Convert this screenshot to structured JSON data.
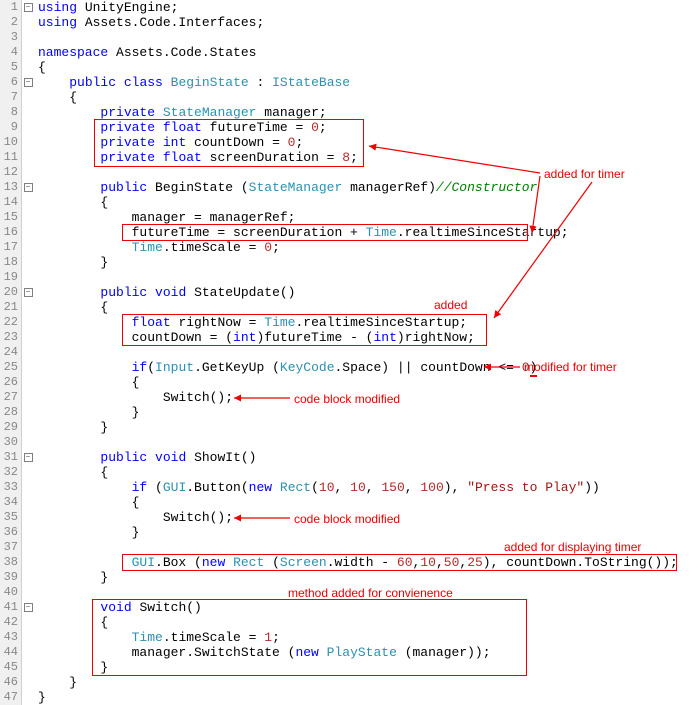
{
  "lines": {
    "l1": [
      "using ",
      "UnityEngine",
      ";"
    ],
    "l2": [
      "using ",
      "Assets.Code.Interfaces",
      ";"
    ],
    "l4": [
      "namespace ",
      "Assets.Code.States"
    ],
    "l6": [
      "    ",
      "public",
      "class",
      "BeginState",
      " : ",
      "IStateBase"
    ],
    "l8": [
      "        ",
      "private",
      "StateManager",
      " manager;"
    ],
    "l9": [
      "        ",
      "private",
      "float",
      " futureTime = ",
      "0",
      ";"
    ],
    "l10": [
      "        ",
      "private",
      "int",
      " countDown = ",
      "0",
      ";"
    ],
    "l11": [
      "        ",
      "private",
      "float",
      " screenDuration = ",
      "8",
      ";"
    ],
    "l13": [
      "        ",
      "public",
      " BeginState (",
      "StateManager",
      " managerRef)",
      "//Constructor"
    ],
    "l15": [
      "            manager = managerRef;"
    ],
    "l16": [
      "            futureTime = screenDuration + ",
      "Time",
      ".realtimeSinceStartup;"
    ],
    "l17": [
      "            ",
      "Time",
      ".timeScale = ",
      "0",
      ";"
    ],
    "l20": [
      "        ",
      "public",
      "void",
      " StateUpdate()"
    ],
    "l22": [
      "            ",
      "float",
      " rightNow = ",
      "Time",
      ".realtimeSinceStartup;"
    ],
    "l23": [
      "            countDown = (",
      "int",
      ")futureTime - (",
      "int",
      ")rightNow;"
    ],
    "l25": [
      "            ",
      "if",
      "(",
      "Input",
      ".GetKeyUp (",
      "KeyCode",
      ".Space) || countDown <= ",
      "0",
      ")"
    ],
    "l27": [
      "                Switch();"
    ],
    "l31": [
      "        ",
      "public",
      "void",
      " ShowIt()"
    ],
    "l33": [
      "            ",
      "if",
      " (",
      "GUI",
      ".Button(",
      "new",
      "Rect",
      "(",
      "10",
      ", ",
      "10",
      ", ",
      "150",
      ", ",
      "100",
      "), ",
      "\"Press to Play\"",
      "))"
    ],
    "l35": [
      "                Switch();"
    ],
    "l38": [
      "            ",
      "GUI",
      ".Box (",
      "new",
      "Rect",
      " (",
      "Screen",
      ".width - ",
      "60",
      ",",
      "10",
      ",",
      "50",
      ",",
      "25",
      "), countDown.ToString());"
    ],
    "l41": [
      "        ",
      "void",
      " Switch()"
    ],
    "l43": [
      "            ",
      "Time",
      ".timeScale = ",
      "1",
      ";"
    ],
    "l44": [
      "            manager.SwitchState (",
      "new",
      "PlayState",
      " (manager));"
    ]
  },
  "ann": {
    "a1": "added for timer",
    "a2": "added",
    "a3": "modified for timer",
    "a4": "code block modified",
    "a5": "code block modified",
    "a6": "added for displaying timer",
    "a7": "method added for convienence"
  },
  "chart_data": null
}
